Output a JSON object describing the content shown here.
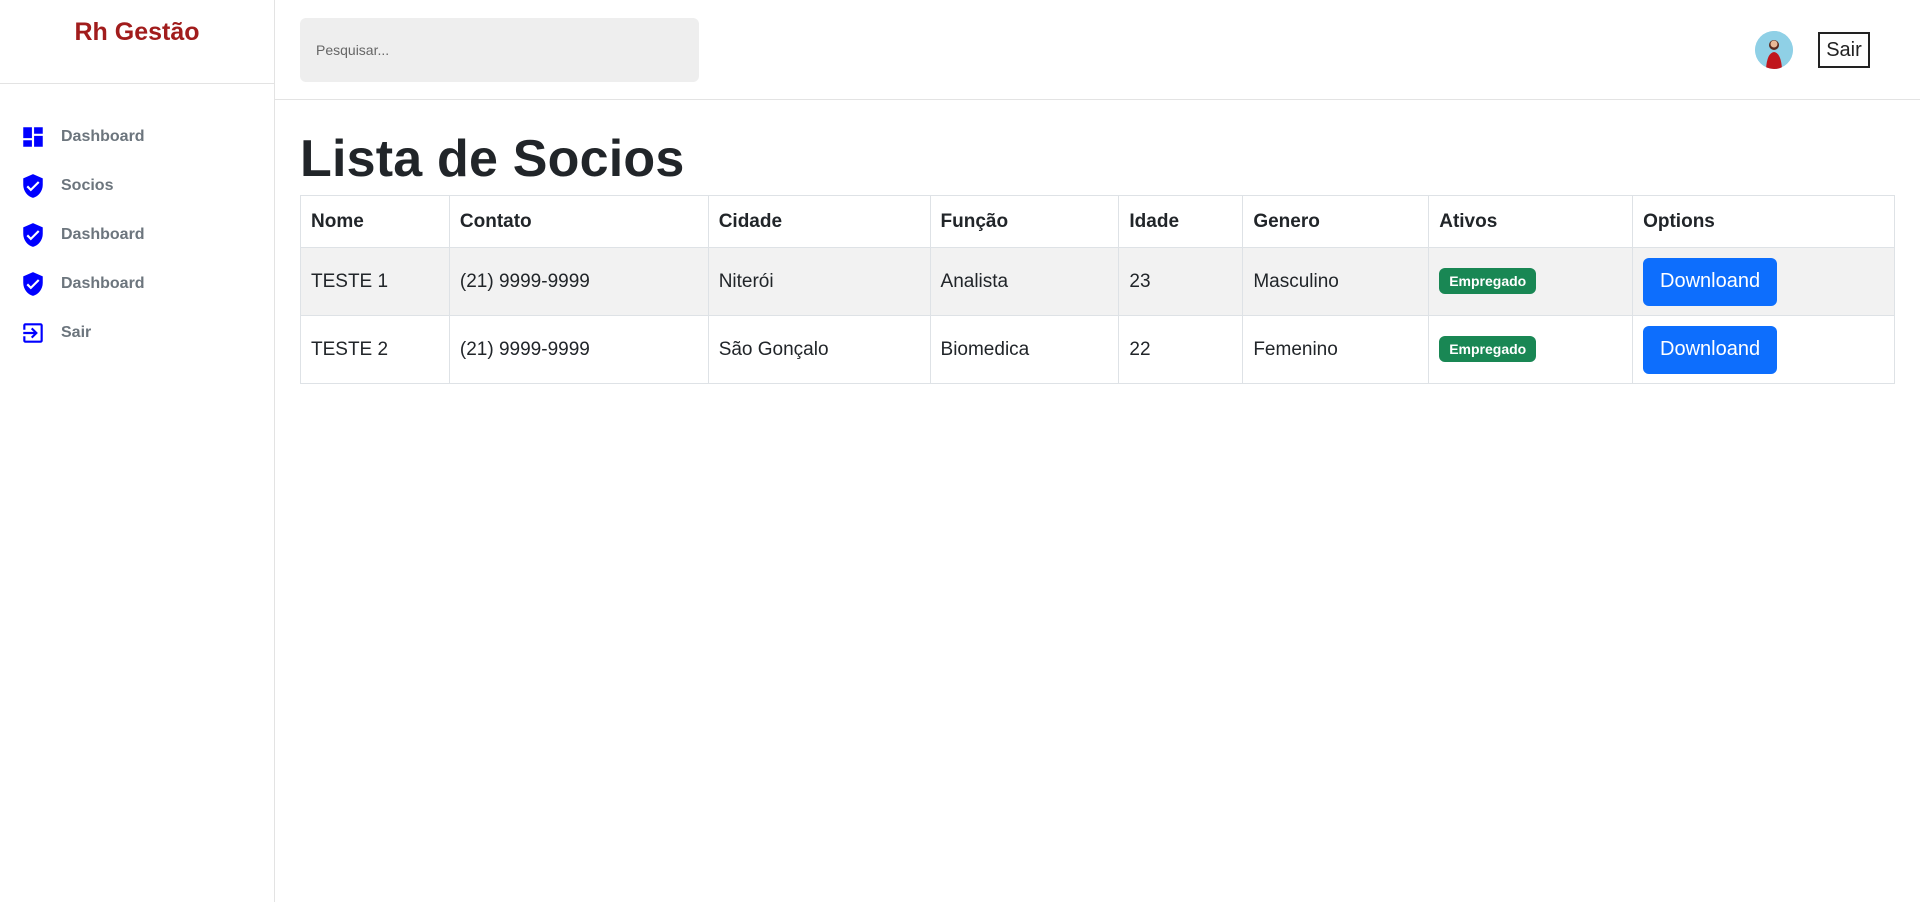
{
  "brand": {
    "title": "Rh Gestão"
  },
  "sidebar": {
    "items": [
      {
        "label": "Dashboard",
        "icon": "dashboard-icon"
      },
      {
        "label": "Socios",
        "icon": "shield-check-icon"
      },
      {
        "label": "Dashboard",
        "icon": "shield-check-icon"
      },
      {
        "label": "Dashboard",
        "icon": "shield-check-icon"
      },
      {
        "label": "Sair",
        "icon": "logout-icon"
      }
    ],
    "icon_color": "#0000ff"
  },
  "header": {
    "search_placeholder": "Pesquisar...",
    "logout_label": "Sair"
  },
  "main": {
    "title": "Lista de Socios",
    "table": {
      "columns": [
        "Nome",
        "Contato",
        "Cidade",
        "Função",
        "Idade",
        "Genero",
        "Ativos",
        "Options"
      ],
      "rows": [
        {
          "nome": "TESTE 1",
          "contato": "(21) 9999-9999",
          "cidade": "Niterói",
          "funcao": "Analista",
          "idade": "23",
          "genero": "Masculino",
          "ativo": "Empregado",
          "action": "Downloand"
        },
        {
          "nome": "TESTE 2",
          "contato": "(21) 9999-9999",
          "cidade": "São Gonçalo",
          "funcao": "Biomedica",
          "idade": "22",
          "genero": "Femenino",
          "ativo": "Empregado",
          "action": "Downloand"
        }
      ]
    }
  },
  "colors": {
    "brand": "#a11c1c",
    "badge_success": "#198754",
    "button_primary": "#0d6efd"
  }
}
